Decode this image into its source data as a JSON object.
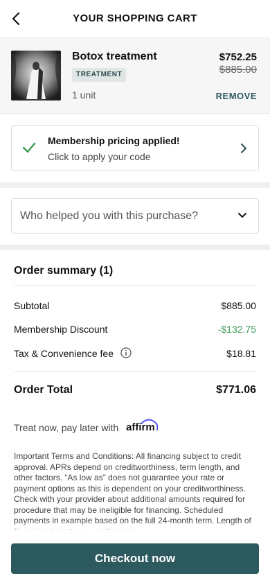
{
  "header": {
    "title": "YOUR SHOPPING CART",
    "back_icon": "chevron-left-icon"
  },
  "cart_item": {
    "name": "Botox treatment",
    "badge": "TREATMENT",
    "units": "1 unit",
    "price": "$752.25",
    "original_price": "$885.00",
    "remove_label": "REMOVE"
  },
  "membership": {
    "title": "Membership pricing applied!",
    "subtitle": "Click to apply your code",
    "icon": "check-icon"
  },
  "helper": {
    "placeholder": "Who helped you with this purchase?",
    "icon": "chevron-down-icon"
  },
  "summary": {
    "title": "Order summary (1)",
    "rows": [
      {
        "label": "Subtotal",
        "value": "$885.00"
      },
      {
        "label": "Membership Discount",
        "value": "-$132.75"
      },
      {
        "label": "Tax & Convenience fee",
        "value": "$18.81"
      }
    ],
    "total_label": "Order Total",
    "total_value": "$771.06"
  },
  "financing": {
    "text": "Treat now, pay later with",
    "brand": "affirm",
    "terms": "Important Terms and Conditions: All financing subject to credit approval. APRs depend on creditworthiness, term length, and other factors. “As low as” does not guarantee your rate or payment options as this is dependent on your creditworthiness. Check with your provider about additional amounts required for procedure that may be ineligible for financing. Scheduled payments in example based on the full 24-month term. Length of financing is up to you and/or your"
  },
  "checkout": {
    "label": "Checkout now"
  },
  "colors": {
    "accent": "#2c5a5e",
    "discount": "#3b9a56",
    "badge_bg": "#dfe6e5"
  }
}
